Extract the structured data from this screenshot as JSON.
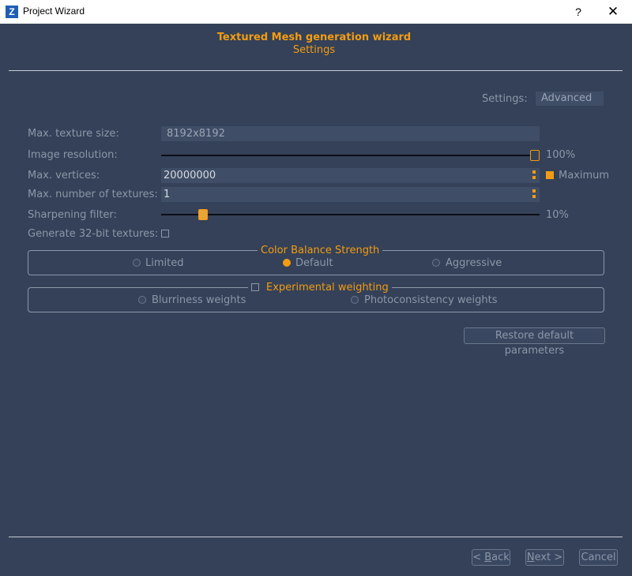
{
  "window": {
    "title": "Project Wizard",
    "logo": "Z",
    "help": "?",
    "close": "✕"
  },
  "header": {
    "title": "Textured Mesh generation wizard",
    "subtitle": "Settings"
  },
  "settings_mode": {
    "label": "Settings:",
    "value": "Advanced"
  },
  "rows": {
    "max_texture_size": {
      "label": "Max. texture size:",
      "value": "8192x8192"
    },
    "image_resolution": {
      "label": "Image resolution:",
      "value": "100%",
      "level": 1.0
    },
    "max_vertices": {
      "label": "Max. vertices:",
      "value": "20000000",
      "maximum_label": "Maximum",
      "maximum_checked": true
    },
    "max_textures": {
      "label": "Max. number of textures:",
      "value": "1"
    },
    "sharpening": {
      "label": "Sharpening filter:",
      "value": "10%",
      "level": 0.1
    },
    "gen32bit": {
      "label": "Generate 32-bit textures:",
      "checked": false
    }
  },
  "color_balance": {
    "title": "Color Balance Strength",
    "options": [
      "Limited",
      "Default",
      "Aggressive"
    ],
    "selected": "Default"
  },
  "experimental": {
    "title": "Experimental weighting",
    "checked": false,
    "options": [
      "Blurriness weights",
      "Photoconsistency weights"
    ]
  },
  "buttons": {
    "restore": "Restore default parameters",
    "back_prefix": "< ",
    "back_key": "B",
    "back_rest": "ack",
    "next_key": "N",
    "next_rest": "ext >",
    "cancel": "Cancel"
  },
  "colors": {
    "accent": "#f39c12",
    "background": "#344158",
    "field": "#3f4d66"
  }
}
